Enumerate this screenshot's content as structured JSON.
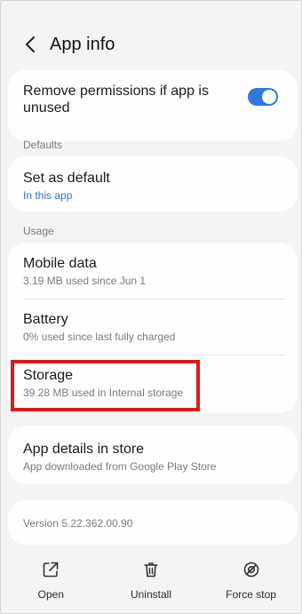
{
  "header": {
    "title": "App info"
  },
  "permissions": {
    "label": "Remove permissions if app is unused",
    "toggle_on": true
  },
  "sections": {
    "defaults": "Defaults",
    "usage": "Usage"
  },
  "defaults": {
    "title": "Set as default",
    "subtitle": "In this app"
  },
  "usage": {
    "mobile_data": {
      "title": "Mobile data",
      "subtitle": "3.19 MB used since Jun 1"
    },
    "battery": {
      "title": "Battery",
      "subtitle": "0% used since last fully charged"
    },
    "storage": {
      "title": "Storage",
      "subtitle": "39.28 MB used in Internal storage"
    }
  },
  "store": {
    "title": "App details in store",
    "subtitle": "App downloaded from Google Play Store"
  },
  "version": "Version 5.22.362.00.90",
  "bottom_bar": {
    "open": "Open",
    "uninstall": "Uninstall",
    "force_stop": "Force stop"
  },
  "colors": {
    "accent": "#3a6fc4",
    "toggle": "#2f7be0",
    "highlight": "#d81c1c"
  },
  "icons": {
    "back": "back-arrow-icon",
    "open": "open-external-icon",
    "uninstall": "trash-icon",
    "force_stop": "stop-circle-icon"
  }
}
